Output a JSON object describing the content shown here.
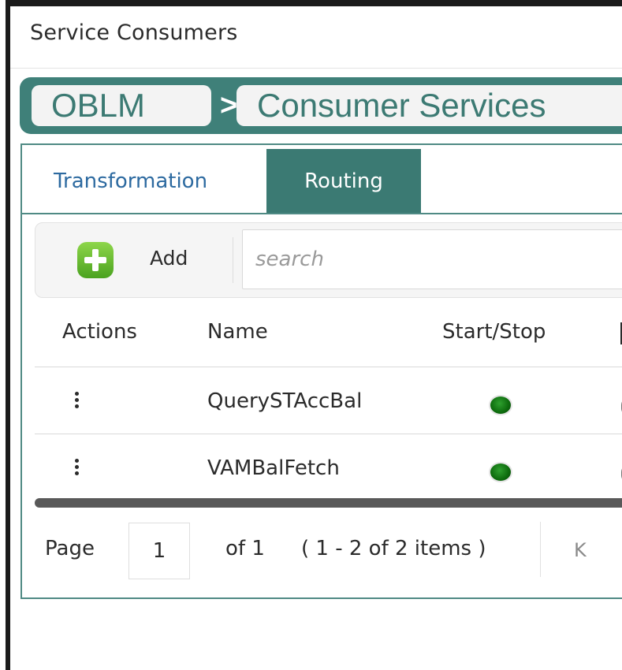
{
  "window": {
    "title": "Service Consumers"
  },
  "breadcrumb": {
    "items": [
      {
        "label": "OBLM"
      },
      {
        "label": "Consumer Services"
      }
    ],
    "separator": ">"
  },
  "tabs": [
    {
      "label": "Transformation",
      "active": false
    },
    {
      "label": "Routing",
      "active": true
    }
  ],
  "toolbar": {
    "add_label": "Add",
    "add_icon": "plus-icon",
    "search_placeholder": "search",
    "search_value": ""
  },
  "table": {
    "columns": [
      "Actions",
      "Name",
      "Start/Stop"
    ],
    "rows": [
      {
        "name": "QuerySTAccBal",
        "status": "started"
      },
      {
        "name": "VAMBalFetch",
        "status": "started"
      }
    ]
  },
  "pagination": {
    "page_label": "Page",
    "page_value": "1",
    "of_label": "of 1",
    "summary": "( 1 - 2 of 2 items )",
    "first_label": "K"
  },
  "colors": {
    "accent": "#3b7a73",
    "tab_link": "#2d6aa0",
    "add_green": "#6cc236",
    "status_green": "#1a8a1a"
  }
}
